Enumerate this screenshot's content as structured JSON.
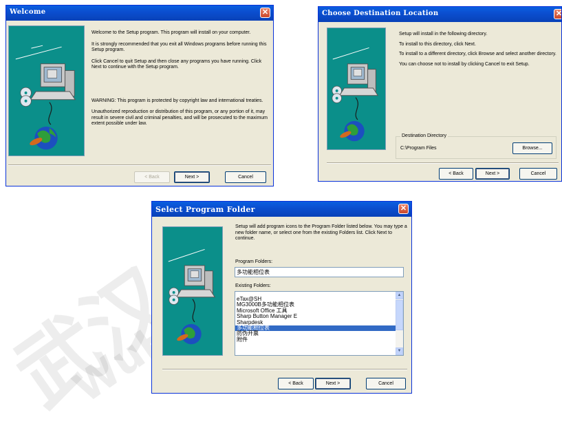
{
  "dialogs": {
    "welcome": {
      "title": "Welcome",
      "close_glyph": "✕",
      "paragraphs": [
        "Welcome to the  Setup program.  This program will install  on your computer.",
        "It is strongly recommended that you exit all Windows programs before running this Setup program.",
        "Click Cancel to quit Setup and then close any programs you have running.  Click Next to continue with the Setup program.",
        "WARNING: This program is protected by copyright law and international treaties.",
        "Unauthorized reproduction or distribution of this program, or any portion of it, may result in severe civil and criminal penalties, and will be prosecuted to the maximum extent possible under law."
      ],
      "back_label": "< Back",
      "next_label": "Next >",
      "cancel_label": "Cancel"
    },
    "destination": {
      "title": "Choose Destination Location",
      "close_glyph": "✕",
      "paragraphs": [
        "Setup will install  in the following directory.",
        "To install to this directory, click Next.",
        "To install to a different directory, click Browse and select another directory.",
        "You can choose not to install  by clicking Cancel to exit Setup."
      ],
      "group_label": "Destination Directory",
      "path": "C:\\Program Files",
      "browse_label": "Browse...",
      "back_label": "< Back",
      "next_label": "Next >",
      "cancel_label": "Cancel"
    },
    "folder": {
      "title": "Select Program Folder",
      "close_glyph": "✕",
      "intro": "Setup will add program icons to the Program Folder listed below. You may type a new folder name, or select one from the existing Folders list.  Click Next to continue.",
      "program_folders_label": "Program Folders:",
      "program_folder_value": "多功能相位表",
      "existing_folders_label": "Existing Folders:",
      "existing_folders": [
        "eTax@SH",
        "MG3000B多功能相位表",
        "Microsoft Office 工具",
        "Sharp Button Manager E",
        "Sharpdesk",
        "多功能相位表",
        "防伪开票",
        "附件"
      ],
      "selected_index": 5,
      "scroll_up_glyph": "▲",
      "scroll_down_glyph": "▼",
      "back_label": "< Back",
      "next_label": "Next >",
      "cancel_label": "Cancel"
    }
  },
  "watermark": {
    "text1": "武汉",
    "text2": "WuH"
  },
  "icons": [
    "close-icon",
    "computer-icon",
    "cd-disc-icon",
    "globe-icon"
  ],
  "colors": {
    "titlebar": "#0a5fe0",
    "side_panel": "#0b8f8a",
    "dialog_bg": "#ece9d8",
    "selection": "#316ac5",
    "close_button": "#c9472a"
  }
}
